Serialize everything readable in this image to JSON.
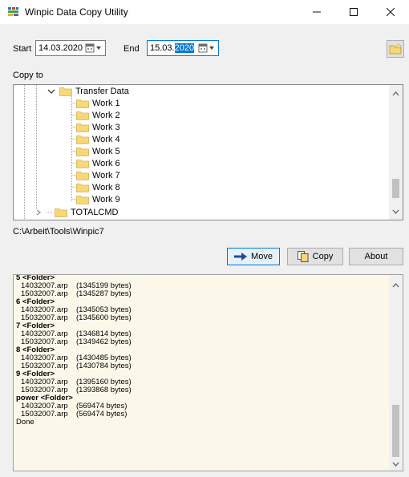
{
  "window": {
    "title": "Winpic Data Copy Utility",
    "minimize": "–",
    "maximize": "☐",
    "close": "✕"
  },
  "dates": {
    "start_label": "Start",
    "start_value": "14.03.2020",
    "end_label": "End",
    "end_value_prefix": "15.03.",
    "end_value_selected": "2020"
  },
  "copy_to": {
    "label": "Copy to",
    "tree": [
      {
        "label": "Transfer Data",
        "level": 0,
        "expanded": true
      },
      {
        "label": "Work 1",
        "level": 1
      },
      {
        "label": "Work 2",
        "level": 1
      },
      {
        "label": "Work 3",
        "level": 1
      },
      {
        "label": "Work 4",
        "level": 1
      },
      {
        "label": "Work 5",
        "level": 1
      },
      {
        "label": "Work 6",
        "level": 1
      },
      {
        "label": "Work 7",
        "level": 1
      },
      {
        "label": "Work 8",
        "level": 1
      },
      {
        "label": "Work 9",
        "level": 1
      },
      {
        "label": "TOTALCMD",
        "level": 0,
        "expanded": false
      }
    ]
  },
  "selected_path": "C:\\Arbeit\\Tools\\Winpic7",
  "buttons": {
    "move": "Move",
    "copy": "Copy",
    "about": "About"
  },
  "log": {
    "lines": [
      {
        "type": "folder",
        "text": "5 <Folder>"
      },
      {
        "type": "file",
        "name": "14032007.arp",
        "size": "(1345199 bytes)"
      },
      {
        "type": "file",
        "name": "15032007.arp",
        "size": "(1345287 bytes)"
      },
      {
        "type": "folder",
        "text": "6 <Folder>"
      },
      {
        "type": "file",
        "name": "14032007.arp",
        "size": "(1345053 bytes)"
      },
      {
        "type": "file",
        "name": "15032007.arp",
        "size": "(1345600 bytes)"
      },
      {
        "type": "folder",
        "text": "7 <Folder>"
      },
      {
        "type": "file",
        "name": "14032007.arp",
        "size": "(1346814 bytes)"
      },
      {
        "type": "file",
        "name": "15032007.arp",
        "size": "(1349462 bytes)"
      },
      {
        "type": "folder",
        "text": "8 <Folder>"
      },
      {
        "type": "file",
        "name": "14032007.arp",
        "size": "(1430485 bytes)"
      },
      {
        "type": "file",
        "name": "15032007.arp",
        "size": "(1430784 bytes)"
      },
      {
        "type": "folder",
        "text": "9 <Folder>"
      },
      {
        "type": "file",
        "name": "14032007.arp",
        "size": "(1395160 bytes)"
      },
      {
        "type": "file",
        "name": "15032007.arp",
        "size": "(1393868 bytes)"
      },
      {
        "type": "folder",
        "text": "power <Folder>"
      },
      {
        "type": "file",
        "name": "14032007.arp",
        "size": "(569474 bytes)"
      },
      {
        "type": "file",
        "name": "15032007.arp",
        "size": "(569474 bytes)"
      },
      {
        "type": "plain",
        "text": "Done"
      }
    ]
  },
  "icons": {
    "app": "winpic-app-icon",
    "calendar": "calendar-dropdown-icon",
    "folder": "folder-icon",
    "settings": "folder-star-icon",
    "move": "arrow-right-icon",
    "copy": "copy-icon"
  },
  "colors": {
    "log_background": "#fbf8ea",
    "selection": "#0078d7",
    "folder": "#f8d775"
  }
}
